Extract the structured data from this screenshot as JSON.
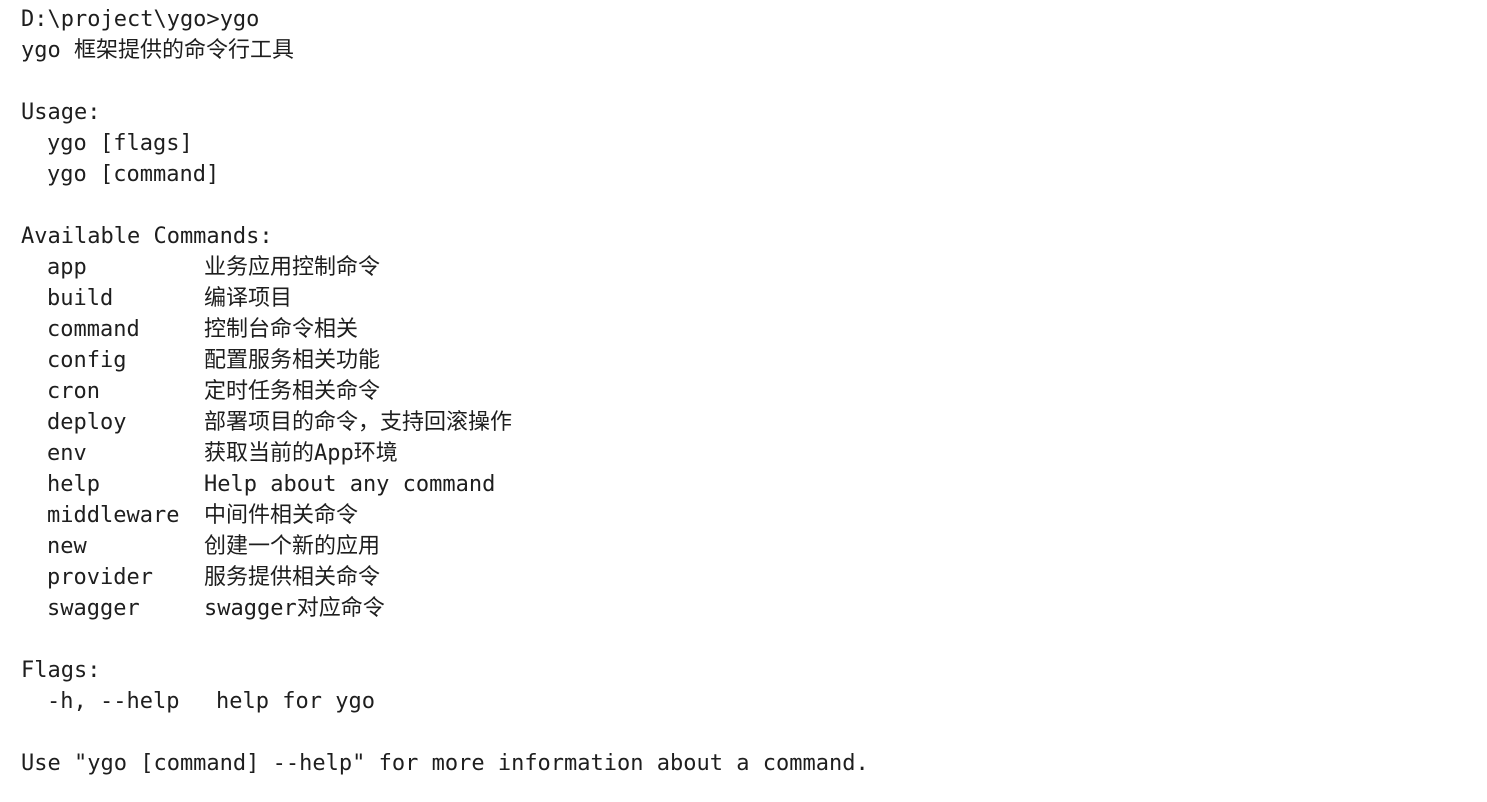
{
  "prompt": {
    "path": "D:\\project\\ygo>",
    "command": "ygo"
  },
  "description": "ygo 框架提供的命令行工具",
  "usage": {
    "heading": "Usage:",
    "lines": [
      "ygo [flags]",
      "ygo [command]"
    ]
  },
  "available_commands": {
    "heading": "Available Commands:",
    "items": [
      {
        "name": "app",
        "desc": "业务应用控制命令"
      },
      {
        "name": "build",
        "desc": "编译项目"
      },
      {
        "name": "command",
        "desc": "控制台命令相关"
      },
      {
        "name": "config",
        "desc": "配置服务相关功能"
      },
      {
        "name": "cron",
        "desc": "定时任务相关命令"
      },
      {
        "name": "deploy",
        "desc": "部署项目的命令，支持回滚操作"
      },
      {
        "name": "env",
        "desc": "获取当前的App环境"
      },
      {
        "name": "help",
        "desc": "Help about any command"
      },
      {
        "name": "middleware",
        "desc": "中间件相关命令"
      },
      {
        "name": "new",
        "desc": "创建一个新的应用"
      },
      {
        "name": "provider",
        "desc": "服务提供相关命令"
      },
      {
        "name": "swagger",
        "desc": "swagger对应命令"
      }
    ]
  },
  "flags": {
    "heading": "Flags:",
    "items": [
      {
        "name": "-h, --help",
        "desc": "help for ygo"
      }
    ]
  },
  "footer": "Use \"ygo [command] --help\" for more information about a command."
}
